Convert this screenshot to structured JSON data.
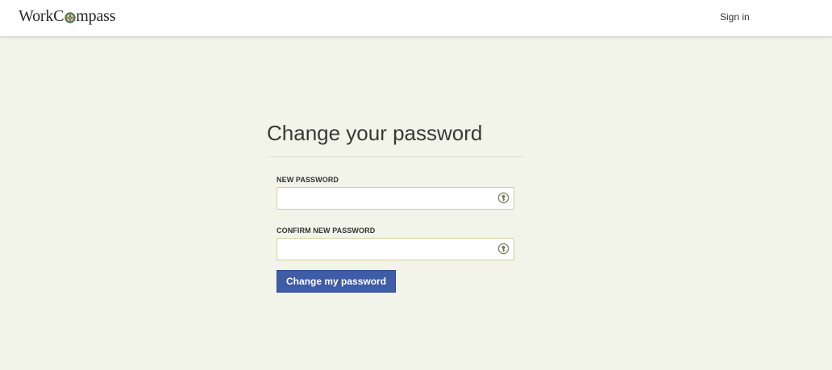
{
  "header": {
    "logo_text_before": "WorkC",
    "logo_text_after": "mpass",
    "logo_icon": "compass-icon",
    "signin_label": "Sign in"
  },
  "main": {
    "title": "Change your password",
    "fields": [
      {
        "label": "NEW PASSWORD",
        "value": "",
        "placeholder": "",
        "icon": "password-manager-key-icon"
      },
      {
        "label": "CONFIRM NEW PASSWORD",
        "value": "",
        "placeholder": "",
        "icon": "password-manager-key-icon"
      }
    ],
    "submit_label": "Change my password"
  },
  "colors": {
    "page_background": "#f2f4e9",
    "header_background": "#ffffff",
    "button_background": "#3f5ca6",
    "input_border": "#d3cf9b"
  }
}
